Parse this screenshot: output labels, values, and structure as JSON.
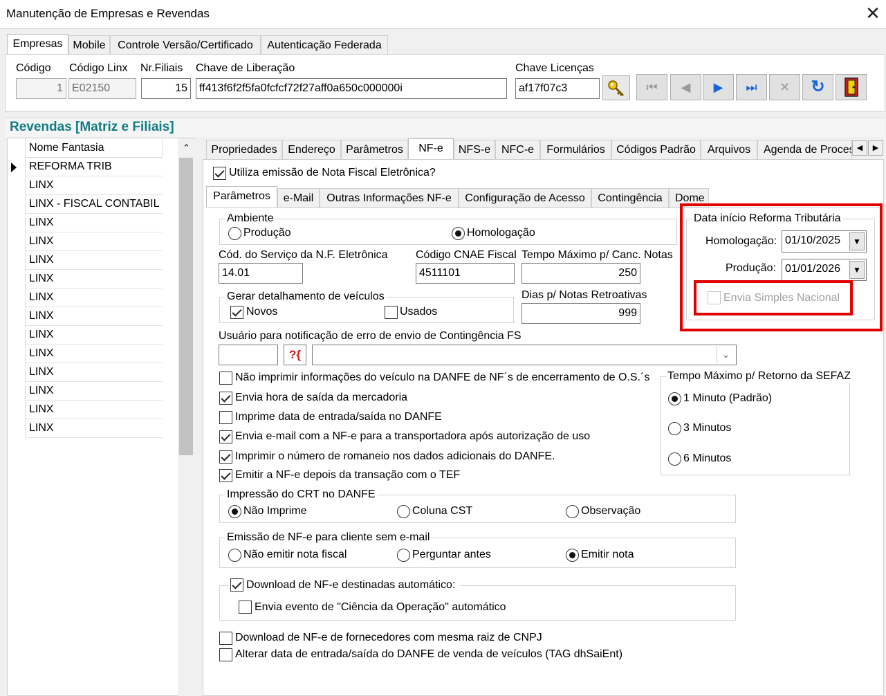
{
  "window": {
    "title": "Manutenção de Empresas e Revendas",
    "close_glyph": "✕"
  },
  "top_tabs": [
    "Empresas",
    "Mobile",
    "Controle Versão/Certificado",
    "Autenticação Federada"
  ],
  "company": {
    "labels": {
      "codigo": "Código",
      "codigo_linx": "Código Linx",
      "nr_filiais": "Nr.Filiais",
      "chave_liberacao": "Chave de Liberação",
      "chave_licencas": "Chave Licenças"
    },
    "values": {
      "codigo": "1",
      "codigo_linx": "E02150",
      "nr_filiais": "15",
      "chave_liberacao": "ff413f6f2f5fa0fcfcf72f27aff0a650c000000i",
      "chave_licencas": "af17f07c3"
    }
  },
  "nav_buttons": [
    {
      "name": "first-record-button",
      "glyph": "⏮",
      "enabled": false
    },
    {
      "name": "previous-record-button",
      "glyph": "◀",
      "enabled": false
    },
    {
      "name": "next-record-button",
      "glyph": "▶",
      "enabled": true
    },
    {
      "name": "last-record-button",
      "glyph": "⏭",
      "enabled": true
    },
    {
      "name": "delete-button",
      "glyph": "✕",
      "enabled": false
    },
    {
      "name": "refresh-button",
      "glyph": "↻",
      "enabled": true
    },
    {
      "name": "exit-button",
      "glyph": "🚪",
      "enabled": true
    }
  ],
  "revendas": {
    "title": "Revendas [Matriz e Filiais]",
    "column": "Nome Fantasia",
    "rows": [
      "REFORMA TRIB",
      "LINX",
      "LINX - FISCAL CONTABIL - ",
      "LINX",
      "LINX",
      "LINX",
      "LINX",
      "LINX",
      "LINX",
      "LINX",
      "LINX",
      "LINX",
      "LINX",
      "LINX",
      "LINX"
    ],
    "selected_index": 0
  },
  "detail_tabs": [
    "Propriedades",
    "Endereço",
    "Parâmetros",
    "NF-e",
    "NFS-e",
    "NFC-e",
    "Formulários",
    "Códigos Padrão",
    "Arquivos",
    "Agenda de Proces"
  ],
  "nfe": {
    "utiliza_label": "Utiliza emissão de Nota Fiscal Eletrônica?",
    "sub_tabs": [
      "Parâmetros",
      "e-Mail",
      "Outras Informações NF-e",
      "Configuração de Acesso",
      "Contingência",
      "Dome"
    ],
    "ambiente": {
      "title": "Ambiente",
      "producao": "Produção",
      "homologacao": "Homologação"
    },
    "cod_servico": {
      "label": "Cód. do Serviço da N.F. Eletrônica",
      "value": "14.01"
    },
    "cnae": {
      "label": "Código CNAE Fiscal",
      "value": "4511101"
    },
    "tempo_canc": {
      "label": "Tempo Máximo p/ Canc. Notas",
      "value": "250"
    },
    "veiculos": {
      "title": "Gerar detalhamento de veículos",
      "novos": "Novos",
      "usados": "Usados"
    },
    "dias_retro": {
      "label": "Dias p/ Notas Retroativas",
      "value": "999"
    },
    "usuario_label": "Usuário para notificação de erro de envio de Contingência FS",
    "help_glyph": "?{",
    "checks": [
      {
        "label": "Não imprimir informações do veículo na DANFE de NF´s de encerramento de O.S.´s",
        "checked": false
      },
      {
        "label": "Envia hora de saída da mercadoria",
        "checked": true
      },
      {
        "label": "Imprime data de entrada/saída no DANFE",
        "checked": false
      },
      {
        "label": "Envia e-mail com a NF-e para a transportadora após autorização de uso",
        "checked": true
      },
      {
        "label": "Imprimir o número de romaneio nos dados adicionais do DANFE.",
        "checked": true
      },
      {
        "label": "Emitir a NF-e depois da transação com o TEF",
        "checked": true
      }
    ],
    "reforma": {
      "title": "Data início Reforma Tributária",
      "homologacao_label": "Homologação:",
      "homologacao_value": "01/10/2025",
      "producao_label": "Produção:",
      "producao_value": "01/01/2026",
      "simples_label": "Envia Simples Nacional"
    },
    "sefaz": {
      "title": "Tempo Máximo p/ Retorno da SEFAZ",
      "options": [
        "1 Minuto (Padrão)",
        "3 Minutos",
        "6 Minutos"
      ]
    },
    "crt": {
      "title": "Impressão do CRT no DANFE",
      "options": [
        "Não Imprime",
        "Coluna CST",
        "Observação"
      ]
    },
    "sem_email": {
      "title": "Emissão de NF-e para cliente sem e-mail",
      "options": [
        "Não emitir nota fiscal",
        "Perguntar antes",
        "Emitir nota"
      ]
    },
    "download": {
      "title": "Download de NF-e destinadas automático:",
      "ciencia": "Envia evento de \"Ciência da Operação\" automático"
    },
    "bottom_checks": [
      {
        "label": "Download de NF-e de fornecedores com mesma raiz de CNPJ",
        "checked": false
      },
      {
        "label": "Alterar data de entrada/saída do DANFE de venda de veículos (TAG dhSaiEnt)",
        "checked": false
      }
    ]
  },
  "colors": {
    "accent_teal": "#0f7b83",
    "highlight_red": "#e00000"
  }
}
